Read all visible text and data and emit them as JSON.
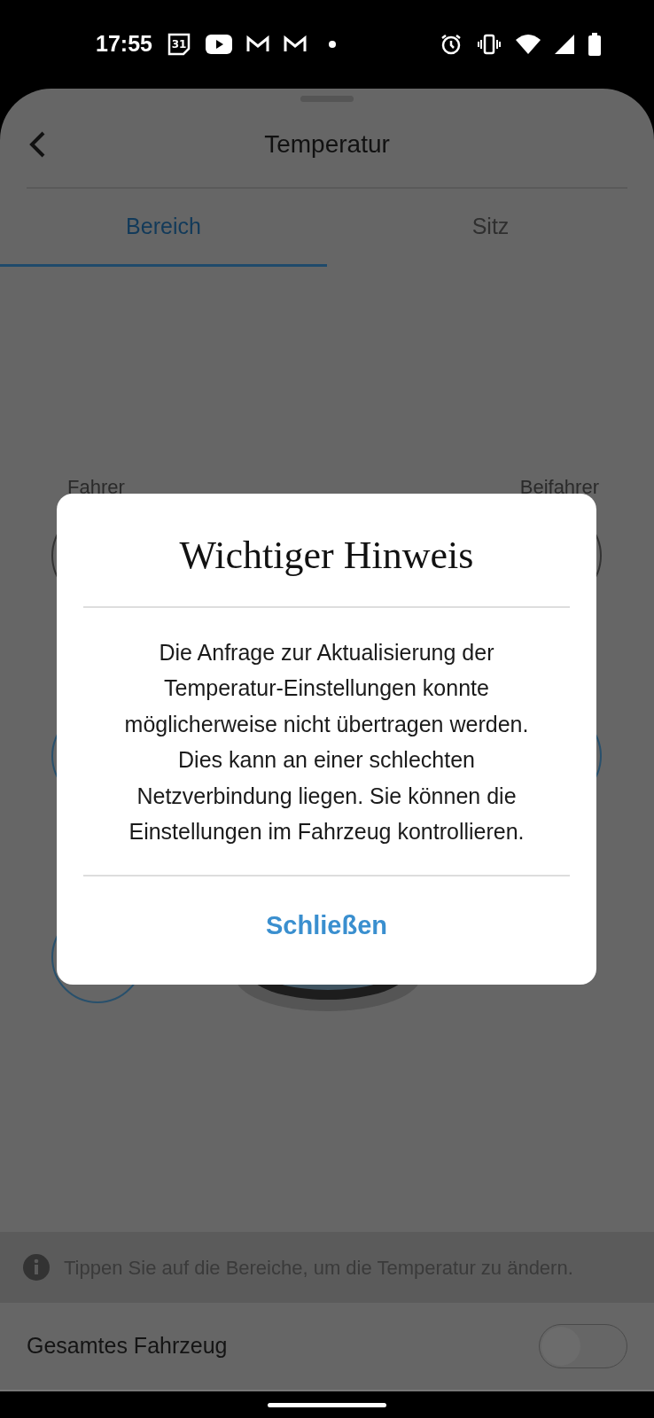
{
  "status_bar": {
    "time": "17:55",
    "calendar_day": "31"
  },
  "header": {
    "title": "Temperatur"
  },
  "tabs": [
    {
      "label": "Bereich",
      "selected": true
    },
    {
      "label": "Sitz",
      "selected": false
    }
  ],
  "zones": [
    {
      "label": "Fahrer"
    },
    {
      "label": "Beifahrer"
    }
  ],
  "dialog": {
    "title": "Wichtiger Hinweis",
    "message": "Die Anfrage zur Aktualisierung der Temperatur-Einstellungen konnte möglicherweise nicht übertragen werden. Dies kann an einer schlechten Netzverbindung liegen. Sie können die Einstellungen im Fahrzeug kontrollieren.",
    "button": "Schließen"
  },
  "info": {
    "text": "Tippen Sie auf die Bereiche, um die Temperatur zu ändern."
  },
  "toggle_row": {
    "label": "Gesamtes Fahrzeug",
    "on": false
  }
}
